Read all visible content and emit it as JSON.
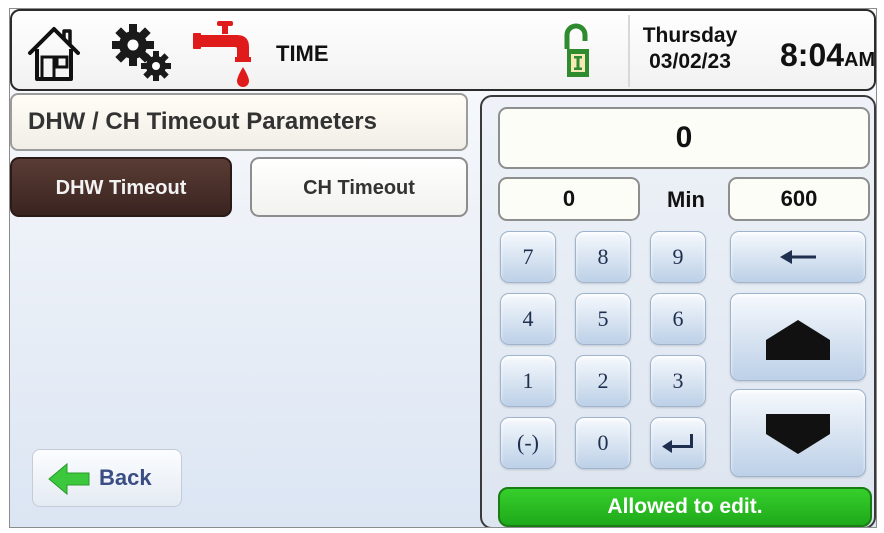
{
  "header": {
    "title": "TIME",
    "day": "Thursday",
    "date": "03/02/23",
    "time": "8:04",
    "ampm": "AM",
    "icons": [
      "home-icon",
      "gears-icon",
      "faucet-icon",
      "unlocked-padlock-icon"
    ]
  },
  "section": {
    "title": "DHW / CH Timeout Parameters"
  },
  "tabs": [
    {
      "label": "DHW Timeout",
      "selected": true
    },
    {
      "label": "CH Timeout",
      "selected": false
    }
  ],
  "keypad": {
    "display_value": "0",
    "range_min": "0",
    "range_unit": "Min",
    "range_max": "600",
    "keys": {
      "k7": "7",
      "k8": "8",
      "k9": "9",
      "k4": "4",
      "k5": "5",
      "k6": "6",
      "k1": "1",
      "k2": "2",
      "k3": "3",
      "kneg": "(-)",
      "k0": "0"
    },
    "status": "Allowed to edit."
  },
  "back": {
    "label": "Back"
  },
  "colors": {
    "selected_tab": "#4a302b",
    "status_green": "#2bbf22",
    "faucet_red": "#e01b1b",
    "lock_green": "#2e8b2e",
    "back_arrow_green": "#3cc83c"
  }
}
